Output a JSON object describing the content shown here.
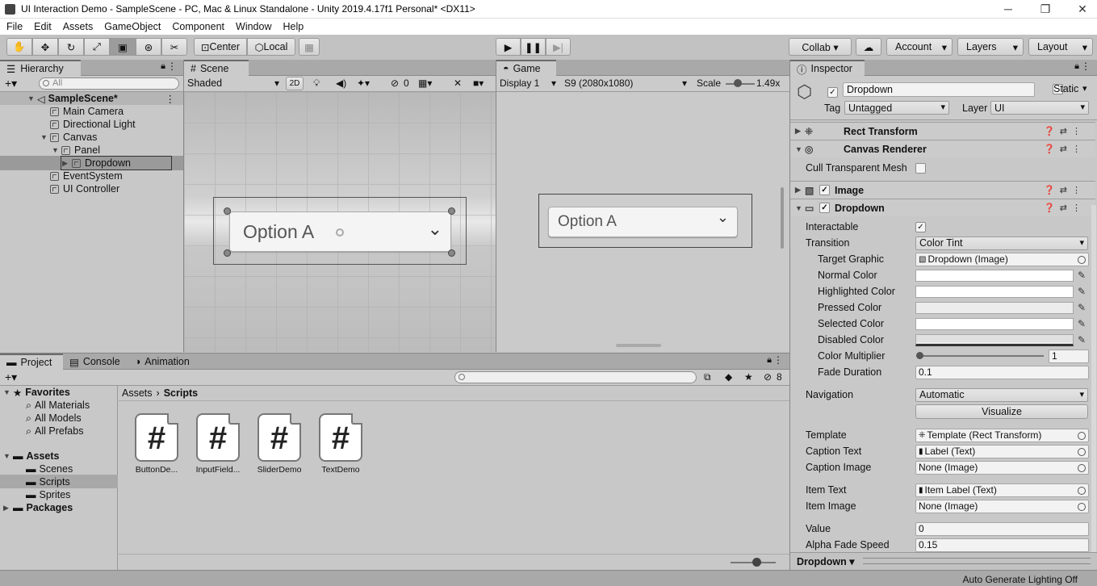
{
  "window": {
    "title": "UI Interaction Demo - SampleScene - PC, Mac & Linux Standalone - Unity 2019.4.17f1 Personal* <DX11>",
    "min": "─",
    "max": "❐",
    "close": "✕"
  },
  "menu": [
    "File",
    "Edit",
    "Assets",
    "GameObject",
    "Component",
    "Window",
    "Help"
  ],
  "toolbar": {
    "center": "Center",
    "local": "Local",
    "collab": "Collab ▾",
    "account": "Account",
    "layers": "Layers",
    "layout": "Layout",
    "cloud": "☁"
  },
  "hierarchy": {
    "tab": "Hierarchy",
    "search": "All",
    "scene": "SampleScene*",
    "items": [
      "Main Camera",
      "Directional Light",
      "Canvas",
      "Panel",
      "Dropdown",
      "EventSystem",
      "UI Controller"
    ]
  },
  "scene": {
    "tab": "Scene",
    "shading": "Shaded",
    "twod": "2D",
    "hidden": "0",
    "dropdown_text": "Option A"
  },
  "game": {
    "tab": "Game",
    "display": "Display 1",
    "resolution": "S9 (2080x1080)",
    "scale_label": "Scale",
    "scale_value": "1.49x",
    "dropdown_text": "Option A"
  },
  "project": {
    "tabs": [
      "Project",
      "Console",
      "Animation"
    ],
    "favorites": "Favorites",
    "fav_items": [
      "All Materials",
      "All Models",
      "All Prefabs"
    ],
    "assets": "Assets",
    "asset_items": [
      "Scenes",
      "Scripts",
      "Sprites"
    ],
    "packages": "Packages",
    "breadcrumb_root": "Assets",
    "breadcrumb_current": "Scripts",
    "hidden_count": "8",
    "files": [
      {
        "icon": "#",
        "name": "ButtonDe..."
      },
      {
        "icon": "#",
        "name": "InputField..."
      },
      {
        "icon": "#",
        "name": "SliderDemo"
      },
      {
        "icon": "#",
        "name": "TextDemo"
      }
    ]
  },
  "inspector": {
    "tab": "Inspector",
    "object_name": "Dropdown",
    "static": "Static",
    "tag_label": "Tag",
    "tag": "Untagged",
    "layer_label": "Layer",
    "layer": "UI",
    "components": [
      "Rect Transform",
      "Canvas Renderer",
      "Image",
      "Dropdown"
    ],
    "cull_label": "Cull Transparent Mesh",
    "interactable": "Interactable",
    "transition": "Transition",
    "transition_value": "Color Tint",
    "target_graphic": "Target Graphic",
    "target_graphic_value": "Dropdown (Image)",
    "normal_color": "Normal Color",
    "highlighted_color": "Highlighted Color",
    "pressed_color": "Pressed Color",
    "selected_color": "Selected Color",
    "disabled_color": "Disabled Color",
    "color_multiplier": "Color Multiplier",
    "color_multiplier_value": "1",
    "fade_duration": "Fade Duration",
    "fade_duration_value": "0.1",
    "navigation": "Navigation",
    "navigation_value": "Automatic",
    "visualize": "Visualize",
    "template": "Template",
    "template_value": "Template (Rect Transform)",
    "caption_text": "Caption Text",
    "caption_text_value": "Label (Text)",
    "caption_image": "Caption Image",
    "caption_image_value": "None (Image)",
    "item_text": "Item Text",
    "item_text_value": "Item Label (Text)",
    "item_image": "Item Image",
    "item_image_value": "None (Image)",
    "value": "Value",
    "value_value": "0",
    "alpha": "Alpha Fade Speed",
    "alpha_value": "0.15",
    "footer": "Dropdown ▾"
  },
  "status": "Auto Generate Lighting Off",
  "colors": {
    "selection": "#8f8f8f",
    "panel": "#c8c8c8",
    "tabbar": "#a9a9a9"
  }
}
